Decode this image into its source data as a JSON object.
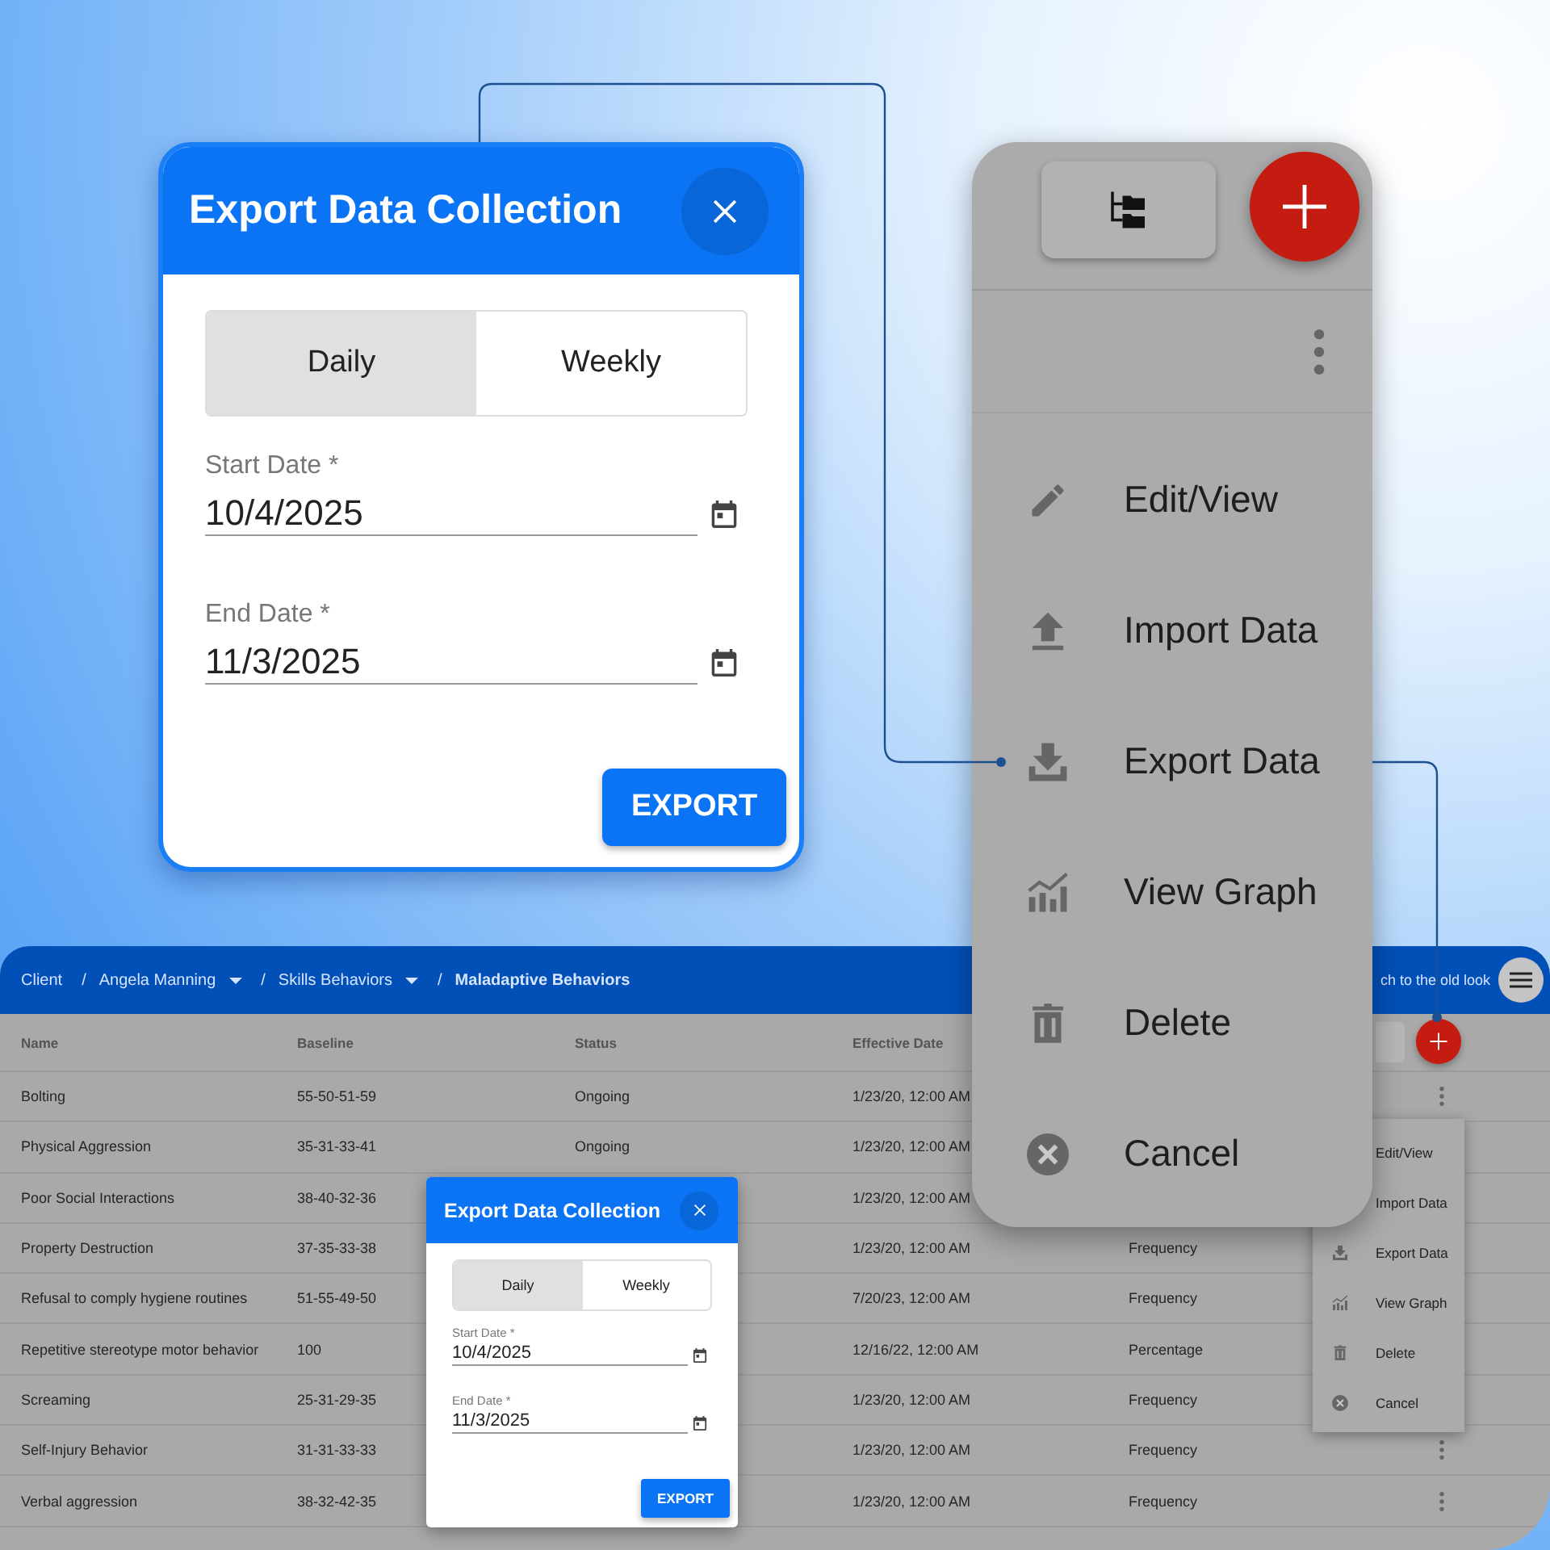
{
  "export_dialog": {
    "title": "Export Data Collection",
    "tabs": [
      {
        "label": "Daily",
        "selected": true
      },
      {
        "label": "Weekly",
        "selected": false
      }
    ],
    "fields": [
      {
        "label": "Start Date *",
        "value": "10/4/2025"
      },
      {
        "label": "End Date *",
        "value": "11/3/2025"
      }
    ],
    "button": "EXPORT"
  },
  "action_menu": {
    "items": [
      {
        "kind": "edit",
        "label": "Edit/View"
      },
      {
        "kind": "import",
        "label": "Import Data"
      },
      {
        "kind": "export",
        "label": "Export Data"
      },
      {
        "kind": "graph",
        "label": "View Graph"
      },
      {
        "kind": "delete",
        "label": "Delete"
      },
      {
        "kind": "cancel",
        "label": "Cancel"
      }
    ]
  },
  "app": {
    "breadcrumb": [
      {
        "label": "Client",
        "dropdown": false,
        "current": false
      },
      {
        "separator": "/",
        "label": "Angela Manning",
        "dropdown": true,
        "current": false
      },
      {
        "separator": "/",
        "label": "Skills Behaviors",
        "dropdown": true,
        "current": false
      },
      {
        "separator": "/",
        "label": "Maladaptive Behaviors",
        "dropdown": false,
        "current": true
      }
    ],
    "switch_link": "ch to the old look",
    "table": {
      "columns": [
        "Name",
        "Baseline",
        "Status",
        "Effective Date"
      ],
      "rows": [
        {
          "name": "Bolting",
          "baseline": "55-50-51-59",
          "status": "Ongoing",
          "effective_date": "1/23/20, 12:00 AM",
          "more_button": true
        },
        {
          "name": "Physical Aggression",
          "baseline": "35-31-33-41",
          "status": "Ongoing",
          "effective_date": "1/23/20, 12:00 AM",
          "more_button": false
        },
        {
          "name": "Poor Social Interactions",
          "baseline": "38-40-32-36",
          "effective_date": "1/23/20, 12:00 AM",
          "more_button": false
        },
        {
          "name": "Property Destruction",
          "baseline": "37-35-33-38",
          "effective_date": "1/23/20, 12:00 AM",
          "column_5": "Frequency",
          "more_button": false
        },
        {
          "name": "Refusal to comply hygiene routines",
          "baseline": "51-55-49-50",
          "effective_date": "7/20/23, 12:00 AM",
          "column_5": "Frequency",
          "more_button": false
        },
        {
          "name": "Repetitive stereotype motor behavior",
          "baseline": "100",
          "effective_date": "12/16/22, 12:00 AM",
          "column_5": "Percentage",
          "more_button": false
        },
        {
          "name": "Screaming",
          "baseline": "25-31-29-35",
          "effective_date": "1/23/20, 12:00 AM",
          "column_5": "Frequency",
          "more_button": false
        },
        {
          "name": "Self-Injury Behavior",
          "baseline": "31-31-33-33",
          "effective_date": "1/23/20, 12:00 AM",
          "column_5": "Frequency",
          "more_button": true
        },
        {
          "name": "Verbal aggression",
          "baseline": "38-32-42-35",
          "effective_date": "1/23/20, 12:00 AM",
          "column_5": "Frequency",
          "more_button": true
        }
      ]
    },
    "row_menu": {
      "items": [
        {
          "label": "Edit/View"
        },
        {
          "label": "Import Data"
        },
        {
          "kind": "export",
          "label": "Export Data"
        },
        {
          "kind": "graph",
          "label": "View Graph"
        },
        {
          "kind": "delete",
          "label": "Delete"
        },
        {
          "kind": "cancel",
          "label": "Cancel"
        }
      ]
    },
    "export_dialog": {
      "title": "Export Data Collection",
      "tabs": [
        {
          "label": "Daily",
          "selected": true
        },
        {
          "label": "Weekly",
          "selected": false
        }
      ],
      "fields": [
        {
          "label": "Start Date *",
          "value": "10/4/2025"
        },
        {
          "label": "End Date *",
          "value": "11/3/2025"
        }
      ],
      "button": "EXPORT"
    }
  }
}
